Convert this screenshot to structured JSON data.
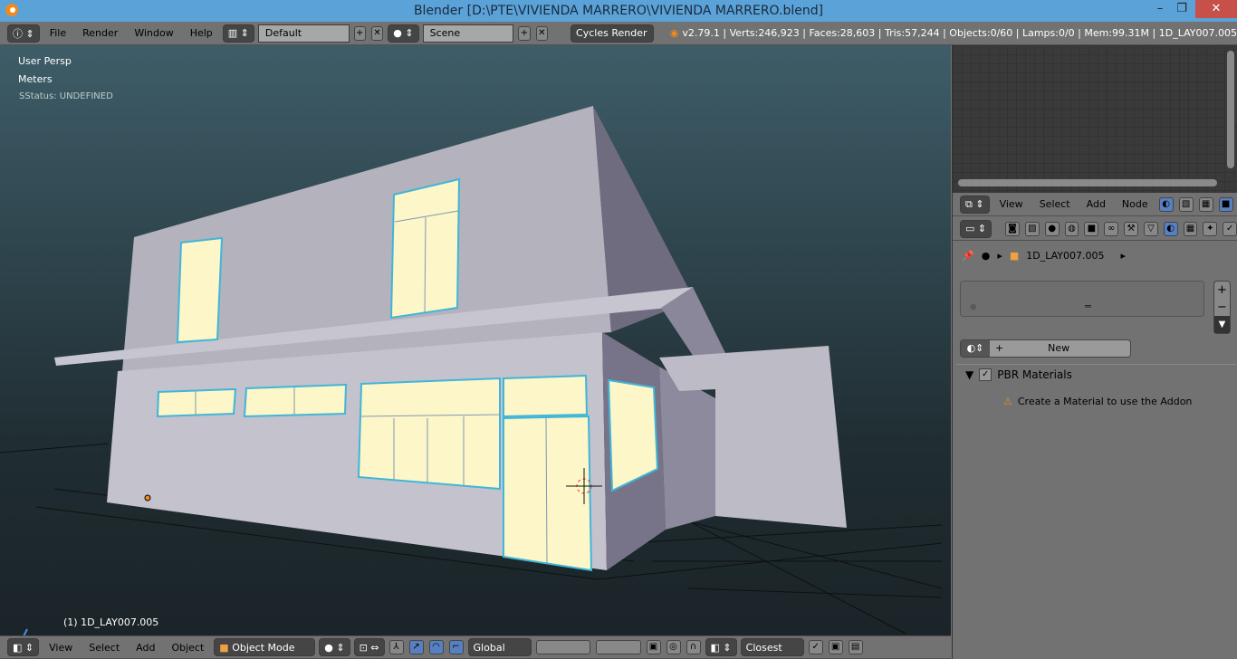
{
  "window": {
    "title": "Blender [D:\\PTE\\VIVIENDA MARRERO\\VIVIENDA MARRERO.blend]",
    "minimize": "–",
    "maximize": "❐",
    "close": "✕"
  },
  "top_header": {
    "menus": [
      "File",
      "Render",
      "Window",
      "Help"
    ],
    "layout": "Default",
    "scene": "Scene",
    "engine": "Cycles Render",
    "stats": "v2.79.1 | Verts:246,923 | Faces:28,603 | Tris:57,244 | Objects:0/60 | Lamps:0/0 | Mem:99.31M | 1D_LAY007.005"
  },
  "viewport": {
    "view_name": "User Persp",
    "units": "Meters",
    "status": "SStatus: UNDEFINED",
    "object_label": "(1) 1D_LAY007.005"
  },
  "bottom_header": {
    "menus": [
      "View",
      "Select",
      "Add",
      "Object"
    ],
    "mode": "Object Mode",
    "orientation": "Global",
    "snap": "Closest"
  },
  "node_header": {
    "menus": [
      "View",
      "Select",
      "Add",
      "Node"
    ]
  },
  "properties": {
    "object_name": "1D_LAY007.005",
    "new_button": "New",
    "panel_title": "PBR Materials",
    "warning": "Create a Material to use the Addon",
    "active_tab": "material"
  },
  "colors": {
    "title_bar": "#5aa2d8",
    "selected": "#5680c2",
    "window_glass": "#fdf6c8",
    "outline": "#3fb6d8"
  }
}
